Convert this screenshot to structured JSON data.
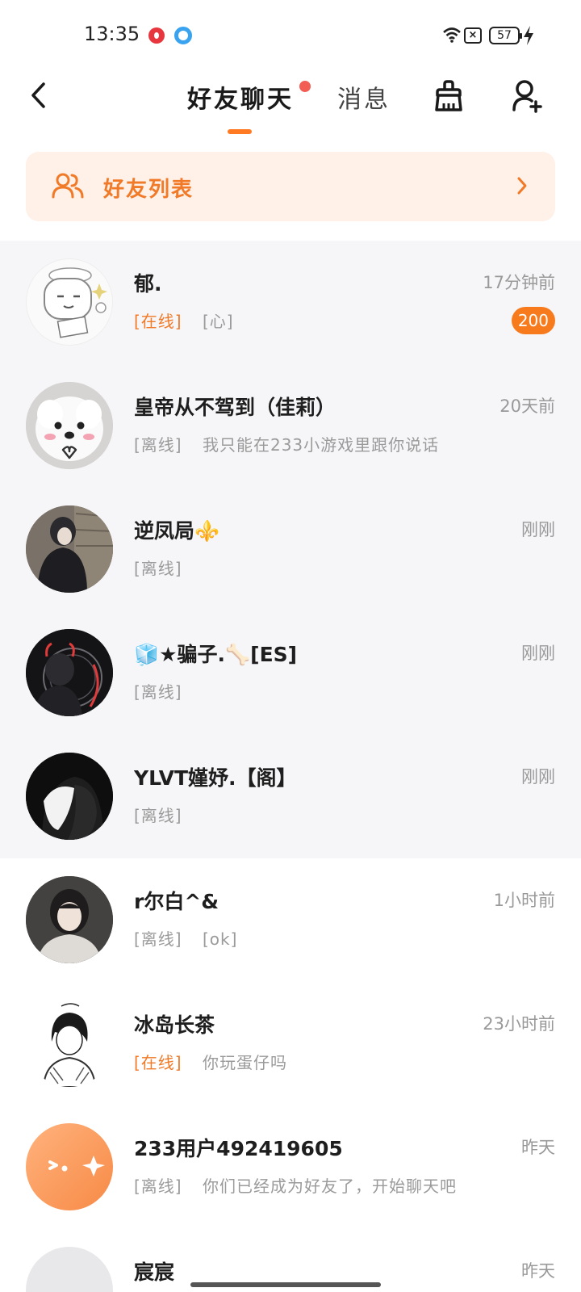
{
  "status_bar": {
    "time": "13:35",
    "battery": "57"
  },
  "nav": {
    "tab_friends": "好友聊天",
    "tab_messages": "消息"
  },
  "friend_list": {
    "label": "好友列表"
  },
  "chats": [
    {
      "name": "郁.",
      "time": "17分钟前",
      "status": "[在线]",
      "message": "[心]",
      "unread": "200"
    },
    {
      "name": "皇帝从不驾到（佳莉）",
      "time": "20天前",
      "status": "[离线]",
      "message": "我只能在233小游戏里跟你说话"
    },
    {
      "name": "逆凤局⚜️",
      "time": "刚刚",
      "status": "[离线]",
      "message": ""
    },
    {
      "name": "🧊★骗子.🦴[ES]",
      "time": "刚刚",
      "status": "[离线]",
      "message": ""
    },
    {
      "name": "YLVT嫤妤.【阁】",
      "time": "刚刚",
      "status": "[离线]",
      "message": ""
    },
    {
      "name": "r尔白^&",
      "time": "1小时前",
      "status": "[离线]",
      "message": "[ok]"
    },
    {
      "name": "冰岛长茶",
      "time": "23小时前",
      "status": "[在线]",
      "message": "你玩蛋仔吗"
    },
    {
      "name": "233用户492419605",
      "time": "昨天",
      "status": "[离线]",
      "message": "你们已经成为好友了，开始聊天吧"
    },
    {
      "name": "宸宸",
      "time": "昨天",
      "status": "",
      "message": ""
    }
  ],
  "colors": {
    "accent": "#f07a28",
    "badge": "#f77b1d",
    "dot": "#f25d54",
    "banner_bg": "#fff0e8"
  }
}
